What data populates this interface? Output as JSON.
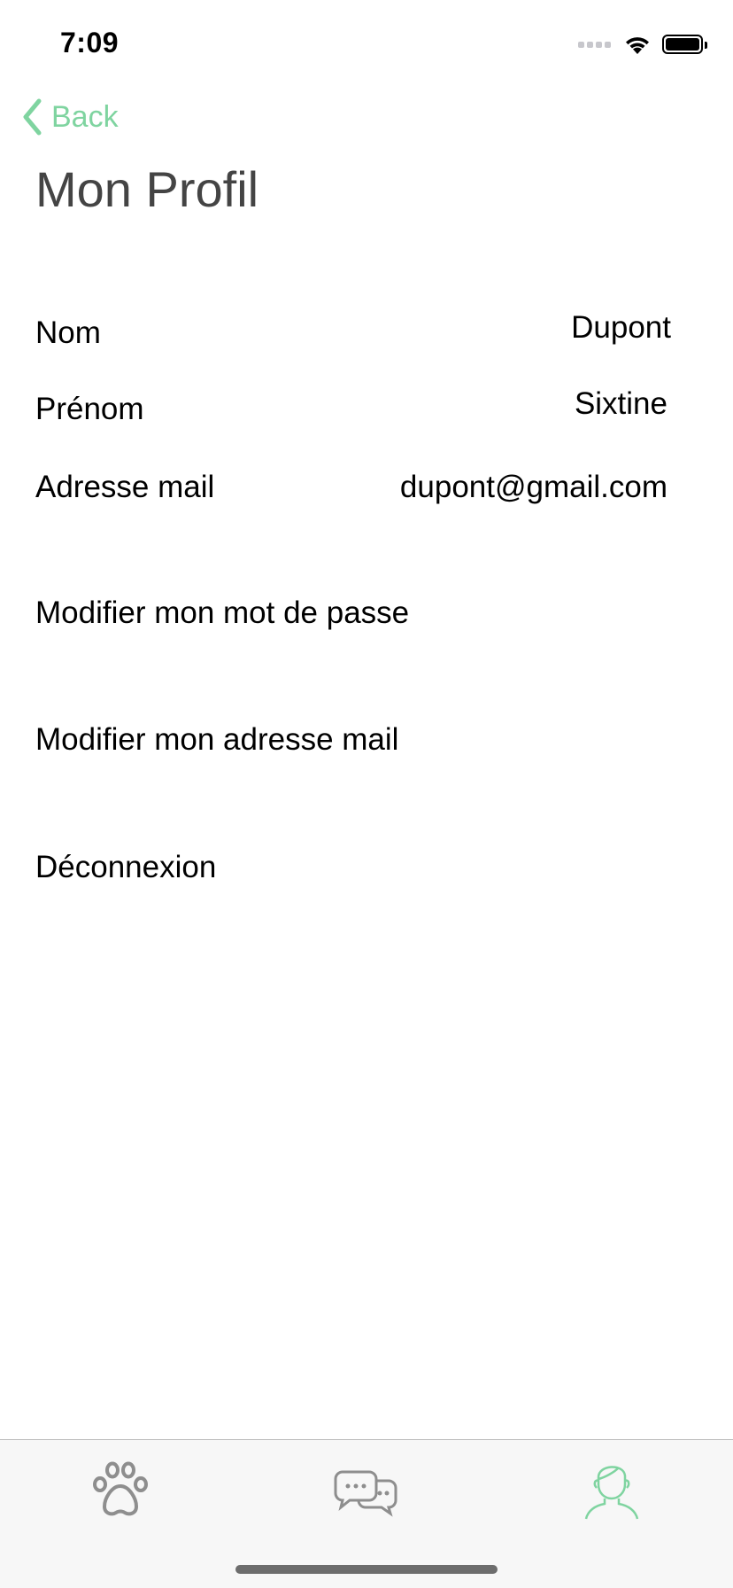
{
  "status_bar": {
    "time": "7:09"
  },
  "nav": {
    "back_label": "Back",
    "accent_color": "#7fd4a0"
  },
  "page": {
    "title": "Mon Profil"
  },
  "profile": {
    "fields": [
      {
        "label": "Nom",
        "value": "Dupont"
      },
      {
        "label": "Prénom",
        "value": "Sixtine"
      },
      {
        "label": "Adresse mail",
        "value": "dupont@gmail.com"
      }
    ]
  },
  "actions": {
    "change_password": "Modifier mon mot de passe",
    "change_email": "Modifier mon adresse mail",
    "logout": "Déconnexion"
  },
  "tab_bar": {
    "tabs": [
      {
        "icon": "paw-icon",
        "active": false
      },
      {
        "icon": "chat-bubbles-icon",
        "active": false
      },
      {
        "icon": "user-profile-icon",
        "active": true
      }
    ],
    "active_color": "#7fd4a0",
    "inactive_color": "#8e8e8e"
  }
}
